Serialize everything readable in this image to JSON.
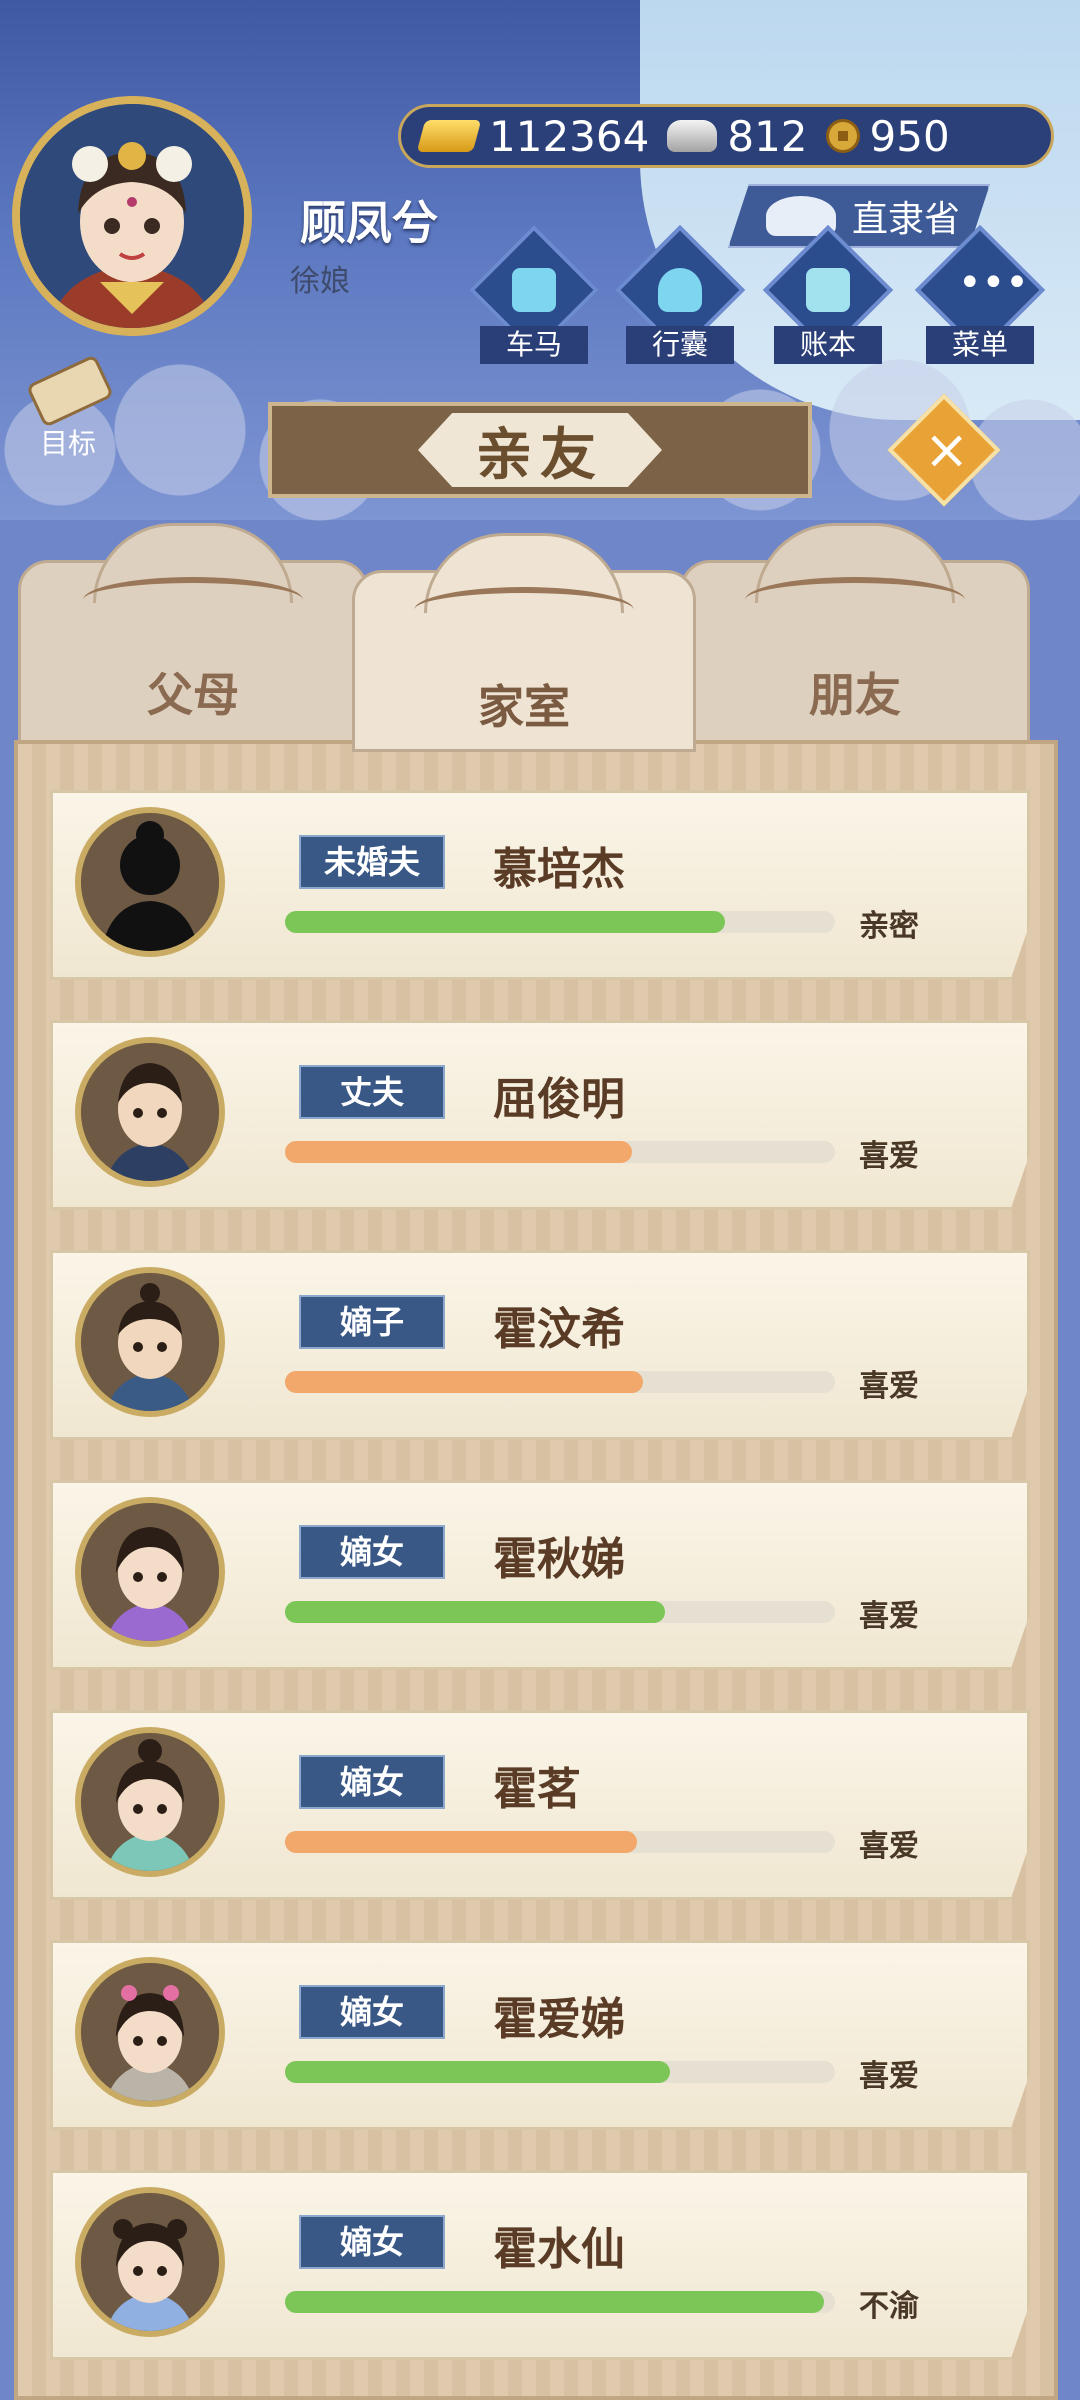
{
  "player": {
    "name": "顾凤兮",
    "title": "徐娘"
  },
  "currency": {
    "gold": "112364",
    "silver": "812",
    "coin": "950"
  },
  "province": "直隶省",
  "menu": [
    {
      "label": "车马",
      "icon": "carriage-icon"
    },
    {
      "label": "行囊",
      "icon": "bag-icon"
    },
    {
      "label": "账本",
      "icon": "ledger-icon"
    },
    {
      "label": "菜单",
      "icon": "more-icon"
    }
  ],
  "goal": {
    "label": "目标"
  },
  "dialog": {
    "title": "亲友"
  },
  "tabs": [
    {
      "label": "父母"
    },
    {
      "label": "家室"
    },
    {
      "label": "朋友"
    }
  ],
  "colors": {
    "green": "#7bc657",
    "orange": "#f2a76b"
  },
  "relatives": [
    {
      "role": "未婚夫",
      "name": "慕培杰",
      "status": "亲密",
      "favor": 0.8,
      "bar": "green"
    },
    {
      "role": "丈夫",
      "name": "屈俊明",
      "status": "喜爱",
      "favor": 0.63,
      "bar": "orange"
    },
    {
      "role": "嫡子",
      "name": "霍汶希",
      "status": "喜爱",
      "favor": 0.65,
      "bar": "orange"
    },
    {
      "role": "嫡女",
      "name": "霍秋娣",
      "status": "喜爱",
      "favor": 0.69,
      "bar": "green"
    },
    {
      "role": "嫡女",
      "name": "霍茗",
      "status": "喜爱",
      "favor": 0.64,
      "bar": "orange"
    },
    {
      "role": "嫡女",
      "name": "霍爱娣",
      "status": "喜爱",
      "favor": 0.7,
      "bar": "green"
    },
    {
      "role": "嫡女",
      "name": "霍水仙",
      "status": "不渝",
      "favor": 0.98,
      "bar": "green"
    }
  ]
}
